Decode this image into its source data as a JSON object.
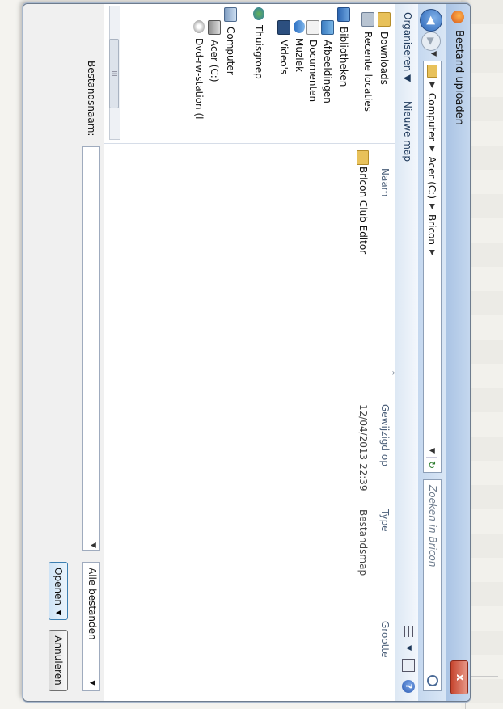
{
  "window": {
    "title": "Bestand uploaden",
    "close_label": "x"
  },
  "nav": {
    "back": "◀",
    "forward": "▶",
    "dropdown": "▼"
  },
  "breadcrumb": {
    "items": [
      "Computer",
      "Acer (C:)",
      "Bricon"
    ],
    "separator": "▶",
    "dropdown": "▼"
  },
  "search": {
    "placeholder": "Zoeken in Bricon"
  },
  "toolbar": {
    "organize": "Organiseren ▼",
    "new_folder": "Nieuwe map",
    "view_dropdown": "▼"
  },
  "sidebar": {
    "items": [
      {
        "label": "Downloads",
        "icon": "folder-icon"
      },
      {
        "label": "Recente locaties",
        "icon": "recent-places-icon"
      },
      {
        "label": "Bibliotheken",
        "icon": "libraries-icon"
      },
      {
        "label": "Afbeeldingen",
        "icon": "pictures-icon"
      },
      {
        "label": "Documenten",
        "icon": "documents-icon"
      },
      {
        "label": "Muziek",
        "icon": "music-icon"
      },
      {
        "label": "Video's",
        "icon": "videos-icon"
      },
      {
        "label": "Thuisgroep",
        "icon": "homegroup-icon"
      },
      {
        "label": "Computer",
        "icon": "computer-icon"
      },
      {
        "label": "Acer (C:)",
        "icon": "drive-icon"
      },
      {
        "label": "Dvd-rw-station (l",
        "icon": "dvd-icon"
      }
    ]
  },
  "table": {
    "columns": [
      "Naam",
      "Gewijzigd op",
      "Type",
      "Grootte"
    ],
    "rows": [
      {
        "name": "Bricon Club Editor",
        "modified": "12/04/2013 22:39",
        "type": "Bestandsmap",
        "size": ""
      }
    ]
  },
  "footer": {
    "filename_label": "Bestandsnaam:",
    "filename_value": "",
    "filter": "Alle bestanden",
    "open_label": "Openen",
    "cancel_label": "Annuleren"
  }
}
